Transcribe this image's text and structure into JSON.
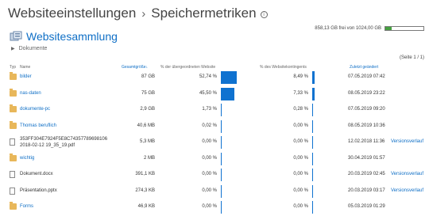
{
  "breadcrumb": {
    "parent": "Websiteeinstellungen",
    "separator": "›",
    "current": "Speichermetriken",
    "info_icon": "info-icon"
  },
  "site": {
    "title": "Websitesammlung",
    "icon": "site-collection-icon",
    "sub_label": "Dokumente",
    "caret_icon": "caret-right-icon"
  },
  "storage": {
    "text": "858,13 GB frei von 1024,00 GB",
    "used_fraction": 0.162,
    "fill_color": "#46a041"
  },
  "pager": "(Seite 1 / 1)",
  "columns": {
    "type": "Typ",
    "name": "Name",
    "size": "Gesamtgröße↓",
    "pct_parent": "% der übergeordneten Website",
    "pct_quota": "% des Websitekontingents",
    "modified": "Zuletzt geändert"
  },
  "colors": {
    "accent": "#0f6fc6",
    "bar": "#0f72d0",
    "folder": "#e8b75a"
  },
  "rows": [
    {
      "kind": "folder",
      "name": "bilder",
      "size": "87 GB",
      "pct_parent": "52,74 %",
      "bar_parent": 0.5274,
      "pct_quota": "8,49 %",
      "bar_quota": 0.0849,
      "modified": "07.05.2019 07:42",
      "version": ""
    },
    {
      "kind": "folder",
      "name": "nas-daten",
      "size": "75 GB",
      "pct_parent": "45,50 %",
      "bar_parent": 0.455,
      "pct_quota": "7,33 %",
      "bar_quota": 0.0733,
      "modified": "08.05.2019 23:22",
      "version": ""
    },
    {
      "kind": "folder",
      "name": "dokumente-pc",
      "size": "2,9 GB",
      "pct_parent": "1,73 %",
      "bar_parent": 0.0173,
      "pct_quota": "0,28 %",
      "bar_quota": 0.0028,
      "modified": "07.05.2019 09:20",
      "version": ""
    },
    {
      "kind": "folder",
      "name": "Thomas beruflich",
      "size": "40,6 MB",
      "pct_parent": "0,02 %",
      "bar_parent": 0.0002,
      "pct_quota": "0,00 %",
      "bar_quota": 0,
      "modified": "08.05.2019 10:36",
      "version": ""
    },
    {
      "kind": "file",
      "name": "353FF304E7924F5E8C74357789698106",
      "name2": "2018-02-12 19_35_19.pdf",
      "size": "5,3 MB",
      "pct_parent": "0,00 %",
      "bar_parent": 0,
      "pct_quota": "0,00 %",
      "bar_quota": 0,
      "modified": "12.02.2018 11:36",
      "version": "Versionsverlauf"
    },
    {
      "kind": "folder",
      "name": "wichtig",
      "size": "2 MB",
      "pct_parent": "0,00 %",
      "bar_parent": 0,
      "pct_quota": "0,00 %",
      "bar_quota": 0,
      "modified": "30.04.2019 01:57",
      "version": ""
    },
    {
      "kind": "file",
      "name": "Dokument.docx",
      "size": "391,1 KB",
      "pct_parent": "0,00 %",
      "bar_parent": 0,
      "pct_quota": "0,00 %",
      "bar_quota": 0,
      "modified": "20.03.2019 02:45",
      "version": "Versionsverlauf"
    },
    {
      "kind": "file",
      "name": "Präsentation.pptx",
      "size": "274,3 KB",
      "pct_parent": "0,00 %",
      "bar_parent": 0,
      "pct_quota": "0,00 %",
      "bar_quota": 0,
      "modified": "20.03.2019 03:17",
      "version": "Versionsverlauf"
    },
    {
      "kind": "folder",
      "name": "Forms",
      "size": "46,9 KB",
      "pct_parent": "0,00 %",
      "bar_parent": 0,
      "pct_quota": "0,00 %",
      "bar_quota": 0,
      "modified": "05.03.2019 01:29",
      "version": ""
    }
  ]
}
